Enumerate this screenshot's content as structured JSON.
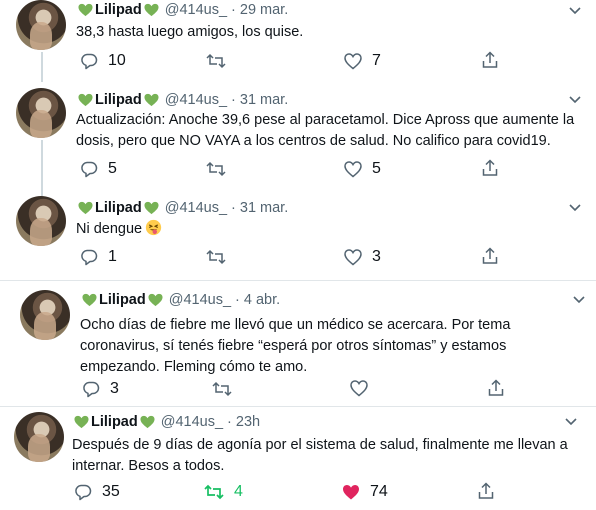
{
  "accent_green": "#5cb85c",
  "liked_red": "#e0245e",
  "retweeted_green": "#17bf63",
  "tweets": [
    {
      "name": "Lilipad",
      "handle": "@414us_",
      "dot": "·",
      "date": "29 mar.",
      "text": "38,3 hasta luego amigos, los quise.",
      "replies": "10",
      "retweets": "",
      "likes": "7"
    },
    {
      "name": "Lilipad",
      "handle": "@414us_",
      "dot": "·",
      "date": "31 mar.",
      "text": "Actualización: Anoche 39,6 pese al paracetamol. Dice Apross que aumente la dosis, pero que NO VAYA a los centros de salud. No califico para covid19.",
      "replies": "5",
      "retweets": "",
      "likes": "5"
    },
    {
      "name": "Lilipad",
      "handle": "@414us_",
      "dot": "·",
      "date": "31 mar.",
      "text": "Ni dengue",
      "emoji": "face-with-tongue",
      "replies": "1",
      "retweets": "",
      "likes": "3"
    },
    {
      "name": "Lilipad",
      "handle": "@414us_",
      "dot": "·",
      "date": "4 abr.",
      "text": "Ocho días de fiebre me llevó que un médico se acercara. Por tema coronavirus, sí tenés fiebre “esperá por otros síntomas” y estamos empezando. Fleming cómo te amo.",
      "replies": "3",
      "retweets": "",
      "likes": ""
    },
    {
      "name": "Lilipad",
      "handle": "@414us_",
      "dot": "·",
      "date": "23h",
      "text": "Después de 9 días de agonía por el sistema de salud, finalmente me llevan a internar. Besos a todos.",
      "replies": "35",
      "retweets": "4",
      "likes": "74",
      "liked": true,
      "retweeted": true
    }
  ]
}
